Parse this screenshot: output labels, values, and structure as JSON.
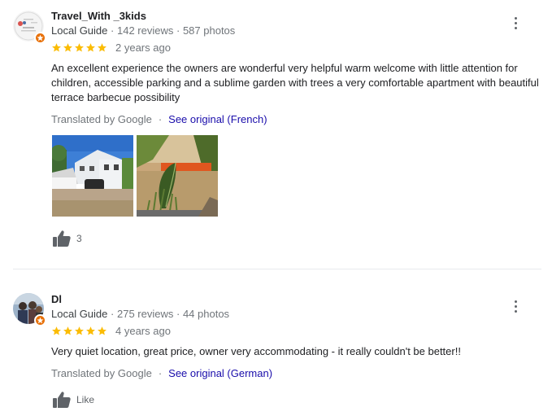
{
  "reviews": [
    {
      "author": "Travel_With _3kids",
      "role": "Local Guide",
      "separator": "·",
      "reviews_count": "142 reviews",
      "photos_count": "587 photos",
      "rating": 5,
      "age": "2 years ago",
      "text": "An excellent experience the owners are wonderful very helpful warm welcome with little attention for children, accessible parking and a sublime garden with trees a very comfortable apartment with beautiful terrace barbecue possibility",
      "translated_label": "Translated by Google",
      "see_original": "See original (French)",
      "likes": "3"
    },
    {
      "author": "Dl",
      "role": "Local Guide",
      "separator": "·",
      "reviews_count": "275 reviews",
      "photos_count": "44 photos",
      "rating": 5,
      "age": "4 years ago",
      "text": "Very quiet location, great price, owner very accommodating - it really couldn't be better!!",
      "translated_label": "Translated by Google",
      "see_original": "See original (German)",
      "likes": "Like"
    }
  ],
  "colors": {
    "star": "#fbbc04",
    "link": "#1a0dab",
    "badge": "#e8710a"
  },
  "icons": {
    "star": "star-icon",
    "thumbs_up": "thumbs-up-icon",
    "more": "more-vert-icon",
    "guide_badge": "local-guide-badge-icon"
  }
}
